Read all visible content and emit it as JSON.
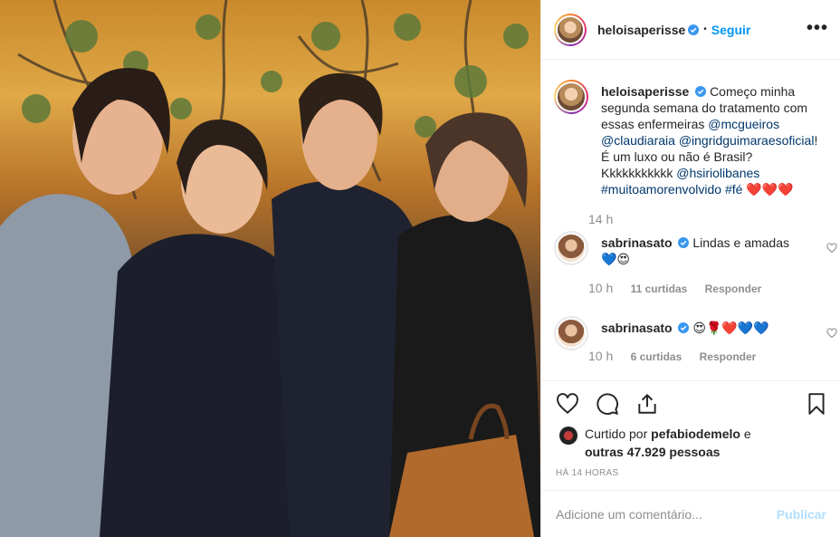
{
  "header": {
    "username": "heloisaperisse",
    "follow_label": "Seguir",
    "more_label": "•••"
  },
  "caption": {
    "username": "heloisaperisse",
    "text": "Começo minha segunda semana do tratamento com essas enfermeiras",
    "mentions": [
      "@mcgueiros",
      "@claudiaraia",
      "@ingridguimaraesoficial"
    ],
    "text2": "! É um luxo ou não é Brasil? Kkkkkkkkkkk",
    "mention4": "@hsiriolibanes",
    "hashtags": [
      "#muitoamorenvolvido",
      "#fé"
    ],
    "emojis": "❤️❤️❤️",
    "time": "14 h"
  },
  "comments": [
    {
      "username": "sabrinasato",
      "text": "Lindas e amadas",
      "emojis": "💙😍",
      "time": "10 h",
      "likes": "11 curtidas",
      "reply": "Responder"
    },
    {
      "username": "sabrinasato",
      "text": "",
      "emojis": "😍🌹❤️💙💙",
      "time": "10 h",
      "likes": "6 curtidas",
      "reply": "Responder"
    }
  ],
  "likes": {
    "prefix": "Curtido por",
    "user": "pefabiodemelo",
    "connector": "e",
    "others": "outras 47.929 pessoas"
  },
  "posted": "HÁ 14 HORAS",
  "add_comment": {
    "placeholder": "Adicione um comentário...",
    "publish": "Publicar"
  },
  "icons": {
    "heart": "heart-icon",
    "comment": "comment-icon",
    "share": "share-icon",
    "save": "bookmark-icon",
    "verified": "verified-badge-icon"
  },
  "colors": {
    "link": "#00376b",
    "follow": "#0095f6",
    "publish_disabled": "#b2dffc"
  }
}
